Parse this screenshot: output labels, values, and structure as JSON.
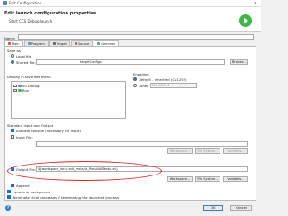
{
  "window": {
    "title": "Edit Configuration"
  },
  "header": {
    "title": "Edit launch configuration properties",
    "subtitle": "Start CCS Debug launch"
  },
  "name": {
    "label": "Name:",
    "value": ""
  },
  "tabs": [
    {
      "label": "Main",
      "icon": "main-icon",
      "color": "#d9534f"
    },
    {
      "label": "Program",
      "icon": "program-icon",
      "color": "#6a8fb8"
    },
    {
      "label": "Target",
      "icon": "target-icon",
      "color": "#666666"
    },
    {
      "label": "Source",
      "icon": "source-icon",
      "color": "#8a6a4a"
    },
    {
      "label": "Common",
      "icon": "common-icon",
      "color": "#6a8fb8"
    }
  ],
  "save_as": {
    "label": "Save as",
    "local_file": "Local file",
    "shared_file": "Shared file:",
    "shared_value": "targetConfigs",
    "browse": "Browse..."
  },
  "favorites": {
    "label": "Display in favorites menu",
    "items": [
      {
        "label": "SS Debug"
      },
      {
        "label": "Run"
      }
    ]
  },
  "encoding": {
    "label": "Encoding",
    "default": "Default - inherited (Cp1252)",
    "other": "Other",
    "other_value": "ISO-8859-1"
  },
  "std_io": {
    "label": "Standard Input and Output",
    "allocate_console": "Allocate console (necessary for input)",
    "input_file": "Input File:",
    "output_file": "Output File:",
    "output_value": "${workspace_loc:/ unit_tests/ut_ResultAllTests.txt}",
    "append": "Append"
  },
  "buttons": {
    "workspace": "Workspace...",
    "file_system": "File System...",
    "variables": "Variables..."
  },
  "launch_background": "Launch in background",
  "terminate_child": "Terminate child processes if terminating the launched process",
  "bottom": {
    "help": "?",
    "ok": "OK",
    "cancel": "Cancel"
  }
}
